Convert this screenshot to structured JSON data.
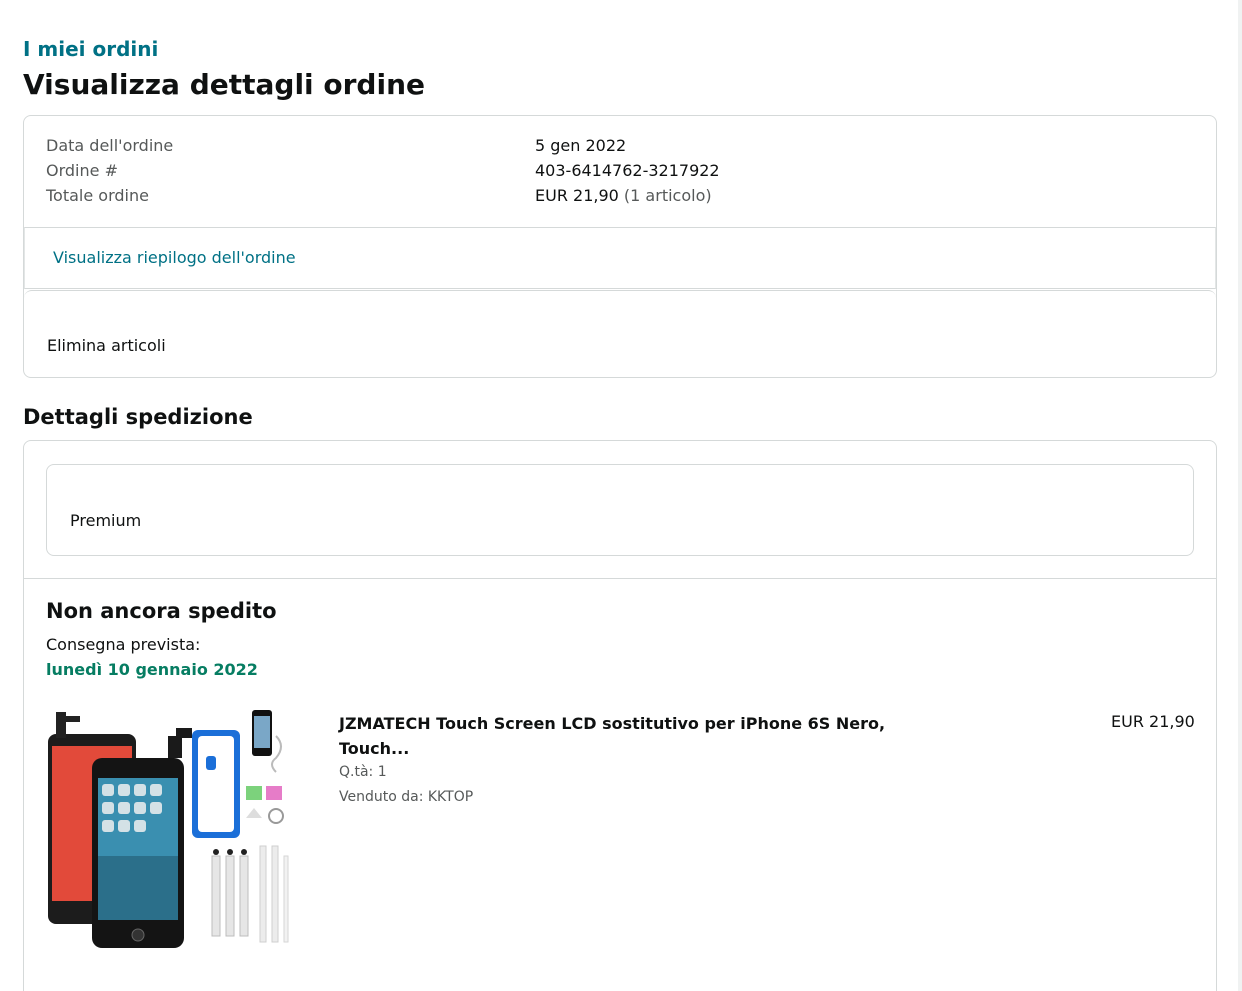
{
  "breadcrumb": "I miei ordini",
  "page_title": "Visualizza dettagli ordine",
  "order_info": {
    "date_label": "Data dell'ordine",
    "date_value": "5 gen 2022",
    "number_label": "Ordine #",
    "number_value": "403-6414762-3217922",
    "total_label": "Totale ordine",
    "total_value": "EUR 21,90",
    "total_items": "(1 articolo)"
  },
  "summary_link": "Visualizza riepilogo dell'ordine",
  "delete_items": "Elimina articoli",
  "shipping": {
    "section_title": "Dettagli spedizione",
    "service": "Premium",
    "status": "Non ancora spedito",
    "delivery_label": "Consegna prevista:",
    "delivery_date": "lunedì 10 gennaio 2022"
  },
  "item": {
    "title": "JZMATECH Touch Screen LCD sostitutivo per iPhone 6S Nero, Touch...",
    "qty": "Q.tà: 1",
    "seller": "Venduto da: KKTOP",
    "price": "EUR 21,90"
  },
  "colors": {
    "link": "#007185",
    "delivery_green": "#067d62",
    "border": "#d5d9d9"
  }
}
